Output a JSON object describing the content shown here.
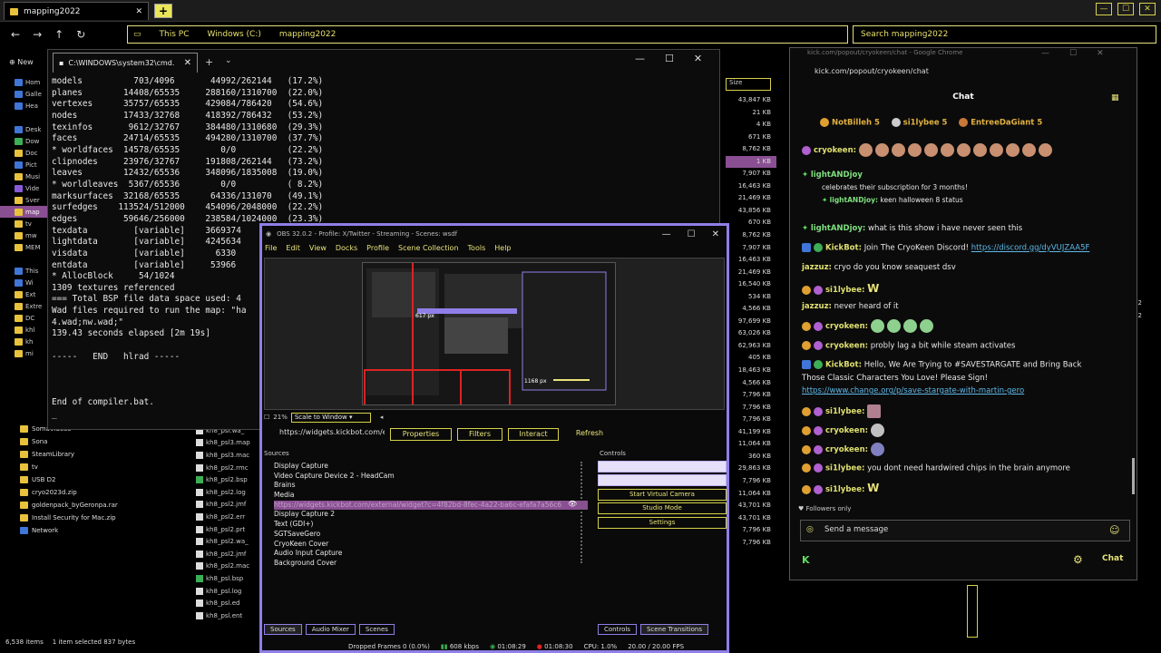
{
  "explorer": {
    "tab_title": "mapping2022",
    "address": [
      "This PC",
      "Windows (C:)",
      "mapping2022"
    ],
    "search_placeholder": "Search mapping2022",
    "nav_first": "New",
    "sidebar": [
      "Hom",
      "Galle",
      "Hea",
      "Desk",
      "Dow",
      "Doc",
      "Pict",
      "Musi",
      "Vide",
      "Sver",
      "map",
      "tv",
      "mw",
      "MEM",
      "This",
      "Wi",
      "Ext",
      "Extre",
      "DC",
      "khl",
      "kh",
      "mi"
    ],
    "lower_items": [
      "SomaVideos",
      "Sona",
      "SteamLibrary",
      "tv",
      "USB D2",
      "cryo2023d.zip",
      "goldenpack_byGeronpa.rar",
      "Install Security for Mac.zip",
      "Network"
    ],
    "files": [
      "kh8_psl.wa_",
      "kh8_psl3.map",
      "kh8_psl3.mac",
      "kh8_psl2.rmc",
      "kh8_psl2.bsp",
      "kh8_psl2.log",
      "kh8_psl2.jmf",
      "kh8_psl2.err",
      "kh8_psl2.prt",
      "kh8_psl2.wa_",
      "kh8_psl2.jmf",
      "kh8_psl2.mac",
      "kh8_psl.bsp",
      "kh8_psl.log",
      "kh8_psl.ed",
      "kh8_psl.ent"
    ],
    "size_header": "Size",
    "sizes": [
      "43,847 KB",
      "21 KB",
      "4 KB",
      "671 KB",
      "8,762 KB",
      "1 KB",
      "7,907 KB",
      "16,463 KB",
      "21,469 KB",
      "43,856 KB",
      "670 KB",
      "8,762 KB",
      "7,907 KB",
      "16,463 KB",
      "21,469 KB",
      "16,540 KB",
      "534 KB",
      "4,566 KB",
      "97,699 KB",
      "63,026 KB",
      "62,963 KB",
      "405 KB",
      "18,463 KB",
      "4,566 KB",
      "7,796 KB",
      "7,796 KB",
      "7,796 KB",
      "41,199 KB",
      "11,064 KB",
      "360 KB",
      "29,863 KB",
      "7,796 KB",
      "11,064 KB",
      "43,701 KB",
      "43,701 KB",
      "7,796 KB",
      "7,796 KB"
    ],
    "right_sizes": [
      "22",
      "22"
    ],
    "status": [
      "6,538 items",
      "1 item selected  837 bytes"
    ]
  },
  "cmd": {
    "tab_title": "C:\\WINDOWS\\system32\\cmd.",
    "lines": [
      "models          703/4096       44992/262144   (17.2%)",
      "planes        14408/65535     288160/1310700  (22.0%)",
      "vertexes      35757/65535     429084/786420   (54.6%)",
      "nodes         17433/32768     418392/786432   (53.2%)",
      "texinfos       9612/32767     384480/1310680  (29.3%)",
      "faces         24714/65535     494280/1310700  (37.7%)",
      "* worldfaces  14578/65535        0/0          (22.2%)",
      "clipnodes     23976/32767     191808/262144   (73.2%)",
      "leaves        12432/65536     348096/1835008  (19.0%)",
      "* worldleaves  5367/65536        0/0          ( 8.2%)",
      "marksurfaces  32168/65535      64336/131070   (49.1%)",
      "surfedges    113524/512000    454096/2048000  (22.2%)",
      "edges         59646/256000    238584/1024000  (23.3%)",
      "texdata         [variable]    3669374",
      "lightdata       [variable]    4245634",
      "visdata         [variable]      6330",
      "entdata         [variable]     53966",
      "* AllocBlock     54/1024",
      "1309 textures referenced",
      "=== Total BSP file data space used: 4",
      "Wad files required to run the map: \"ha",
      "4.wad;nw.wad;\"",
      "139.43 seconds elapsed [2m 19s]",
      "",
      "-----   END   hlrad -----",
      "",
      "",
      "",
      "End of compiler.bat.",
      "_"
    ]
  },
  "obs": {
    "title": "OBS 32.0.2 - Profile: X/Twitter - Streaming - Scenes: wsdf",
    "menu": [
      "File",
      "Edit",
      "View",
      "Docks",
      "Profile",
      "Scene Collection",
      "Tools",
      "Help"
    ],
    "zoom": "21%",
    "scale_option": "Scale to Window",
    "source_url": "https://widgets.kickbot.com/e",
    "toolbar": [
      "Properties",
      "Filters",
      "Interact",
      "Refresh"
    ],
    "sources_label": "Sources",
    "controls_label": "Controls",
    "sources": [
      "Display Capture",
      "Video Capture Device 2 - HeadCam",
      "Brains",
      "Media",
      "https://widgets.kickbot.com/external/widget?c=4f82bd-8fec-4a22-ba6c-efafa7a56c6",
      "Display Capture 2",
      "Text (GDI+)",
      "SGTSaveGero",
      "CryoKeen Cover",
      "Audio Input Capture",
      "Background Cover"
    ],
    "controls": [
      "",
      "",
      "Start Virtual Camera",
      "Studio Mode",
      "Settings"
    ],
    "dock_tabs": [
      "Sources",
      "Audio Mixer",
      "Scenes"
    ],
    "ctl_tabs": [
      "Controls",
      "Scene Transitions"
    ],
    "status": [
      "Dropped Frames 0 (0.0%)",
      "608 kbps",
      "01:08:29",
      "01:08:30",
      "CPU: 1.0%",
      "20.00 / 20.00 FPS"
    ],
    "preview_labels": [
      "617 px",
      "1168 px"
    ]
  },
  "chat": {
    "window_title": "kick.com/popout/cryokeen/chat - Google Chrome",
    "url": "kick.com/popout/cryokeen/chat",
    "header": "Chat",
    "top_gifters": [
      "NotBilleh 5",
      "si1lybee 5",
      "EntreeDaGiant 5"
    ],
    "messages": {
      "m1_user": "cryokeen:",
      "sub_user": "lightANDjoy",
      "sub_text": "celebrates their subscription for 3 months!",
      "sub_msg_user": "lightANDjoy:",
      "sub_msg_text": "keen halloween 8 status",
      "m2_user": "lightANDjoy:",
      "m2_text": "what is this show i have never seen this",
      "m3_user": "KickBot:",
      "m3_text": "Join The CryoKeen Discord!",
      "m3_link": "https://discord.gg/dyVUJZAA5F",
      "m4_user": "jazzuz:",
      "m4_text": "cryo do you know seaquest dsv",
      "m5_user": "si1lybee:",
      "m5_text": "W",
      "m6_user": "jazzuz:",
      "m6_text": "never heard of it",
      "m7_user": "cryokeen:",
      "m8_user": "cryokeen:",
      "m8_text": "probly lag a bit while steam activates",
      "m9_user": "KickBot:",
      "m9_text": "Hello, We Are Trying to #SAVESTARGATE and Bring Back",
      "m9_text2": "Those Classic Characters You Love! Please Sign!",
      "m9_link": "https://www.change.org/p/save-stargate-with-martin-gero",
      "m10_user": "si1lybee:",
      "m11_user": "cryokeen:",
      "m12_user": "cryokeen:",
      "m13_user": "si1lybee:",
      "m13_text": "you dont need hardwired chips in the brain anymore",
      "m14_user": "si1lybee:",
      "m14_text": "W"
    },
    "followers_only": "Followers only",
    "input_placeholder": "Send a message",
    "send_label": "Chat"
  },
  "colors": {
    "accent": "#d7d24a",
    "obs_border": "#8f7fe8",
    "selection": "#8a4f92"
  }
}
